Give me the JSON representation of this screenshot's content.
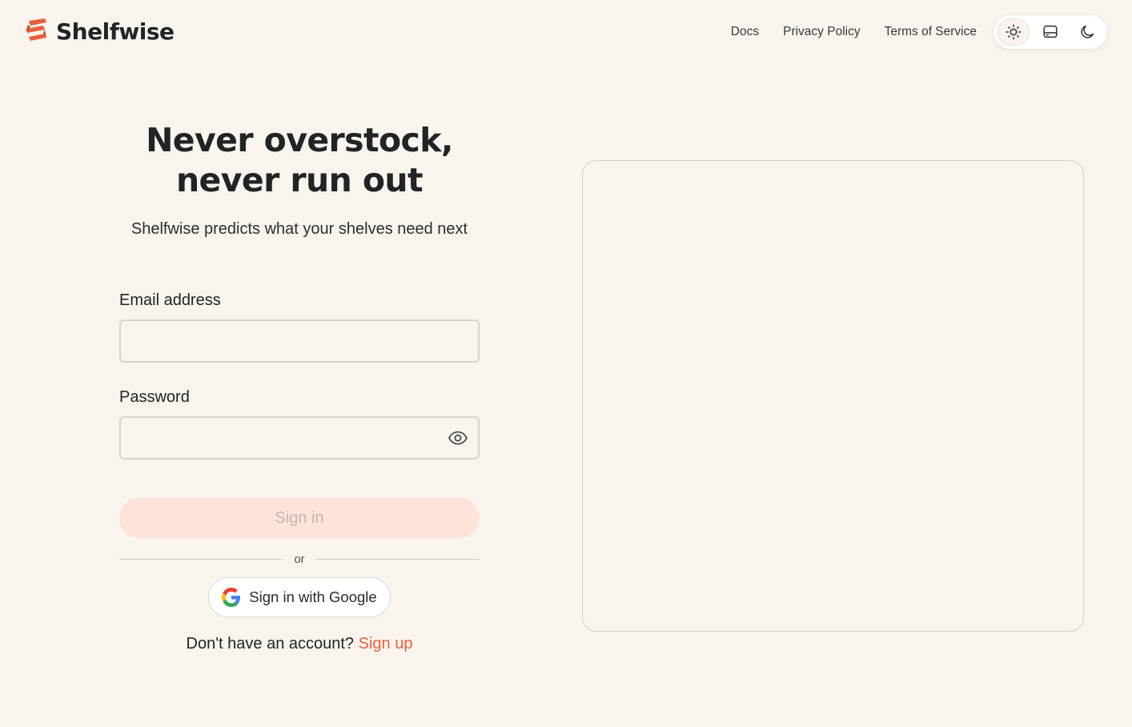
{
  "brand": {
    "name": "Shelfwise",
    "logo_icon": "shelfwise-logo-icon",
    "accent": "#e8603c"
  },
  "nav": {
    "links": [
      "Docs",
      "Privacy Policy",
      "Terms of Service"
    ],
    "theme_toggle": {
      "options": [
        "light-theme-icon",
        "system-theme-icon",
        "dark-theme-icon"
      ],
      "selected": "light-theme-icon"
    }
  },
  "hero": {
    "headline_line1": "Never overstock,",
    "headline_line2": "never run out",
    "subtitle": "Shelfwise predicts what your shelves need next"
  },
  "form": {
    "email_label": "Email address",
    "email_value": "",
    "password_label": "Password",
    "password_value": "",
    "password_toggle_icon": "eye-icon",
    "signin_label": "Sign in",
    "signin_disabled": true,
    "divider_text": "or",
    "google_label": "Sign in with Google",
    "google_icon": "google-icon",
    "signup_prompt": "Don't have an account?",
    "signup_link": "Sign up"
  },
  "colors": {
    "background": "#f9f4ee",
    "accent": "#e8603c",
    "signin_disabled_bg": "#fde3d8"
  }
}
